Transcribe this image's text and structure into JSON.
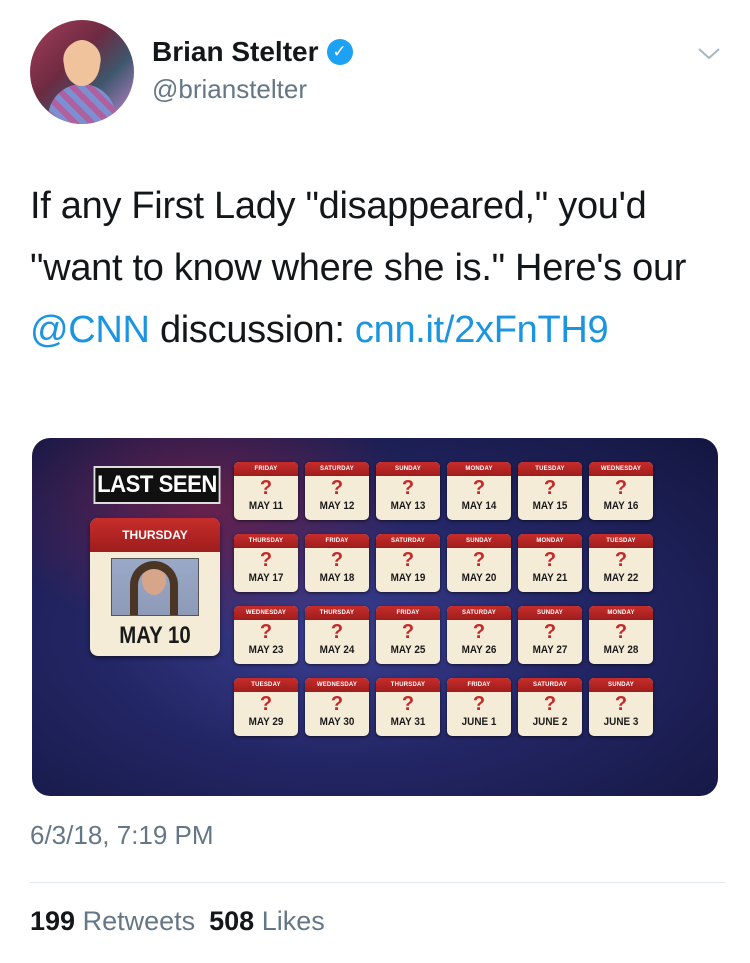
{
  "author": {
    "display_name": "Brian Stelter",
    "handle": "@brianstelter",
    "verified_icon": "verified-badge-icon",
    "menu_icon": "chevron-down-icon"
  },
  "tweet": {
    "text_parts": [
      "If any First Lady \"disappeared,\" you'd \"want to know where she is.\" Here's our ",
      "@CNN",
      " discussion: ",
      "cnn.it/​2xFnTH9"
    ],
    "timestamp": "6/3/18, 7:19 PM"
  },
  "media": {
    "last_seen_label": "LAST SEEN",
    "last_seen_day": "THURSDAY",
    "last_seen_date": "MAY 10",
    "calendars": [
      {
        "dow": "FRIDAY",
        "date": "MAY 11"
      },
      {
        "dow": "SATURDAY",
        "date": "MAY 12"
      },
      {
        "dow": "SUNDAY",
        "date": "MAY 13"
      },
      {
        "dow": "MONDAY",
        "date": "MAY 14"
      },
      {
        "dow": "TUESDAY",
        "date": "MAY 15"
      },
      {
        "dow": "WEDNESDAY",
        "date": "MAY 16"
      },
      {
        "dow": "THURSDAY",
        "date": "MAY 17"
      },
      {
        "dow": "FRIDAY",
        "date": "MAY 18"
      },
      {
        "dow": "SATURDAY",
        "date": "MAY 19"
      },
      {
        "dow": "SUNDAY",
        "date": "MAY 20"
      },
      {
        "dow": "MONDAY",
        "date": "MAY 21"
      },
      {
        "dow": "TUESDAY",
        "date": "MAY 22"
      },
      {
        "dow": "WEDNESDAY",
        "date": "MAY 23"
      },
      {
        "dow": "THURSDAY",
        "date": "MAY 24"
      },
      {
        "dow": "FRIDAY",
        "date": "MAY 25"
      },
      {
        "dow": "SATURDAY",
        "date": "MAY 26"
      },
      {
        "dow": "SUNDAY",
        "date": "MAY 27"
      },
      {
        "dow": "MONDAY",
        "date": "MAY 28"
      },
      {
        "dow": "TUESDAY",
        "date": "MAY 29"
      },
      {
        "dow": "WEDNESDAY",
        "date": "MAY 30"
      },
      {
        "dow": "THURSDAY",
        "date": "MAY 31"
      },
      {
        "dow": "FRIDAY",
        "date": "JUNE 1"
      },
      {
        "dow": "SATURDAY",
        "date": "JUNE 2"
      },
      {
        "dow": "SUNDAY",
        "date": "JUNE 3"
      }
    ],
    "unknown_mark": "?"
  },
  "stats": {
    "retweets_count": "199",
    "retweets_label": "Retweets",
    "likes_count": "508",
    "likes_label": "Likes"
  }
}
